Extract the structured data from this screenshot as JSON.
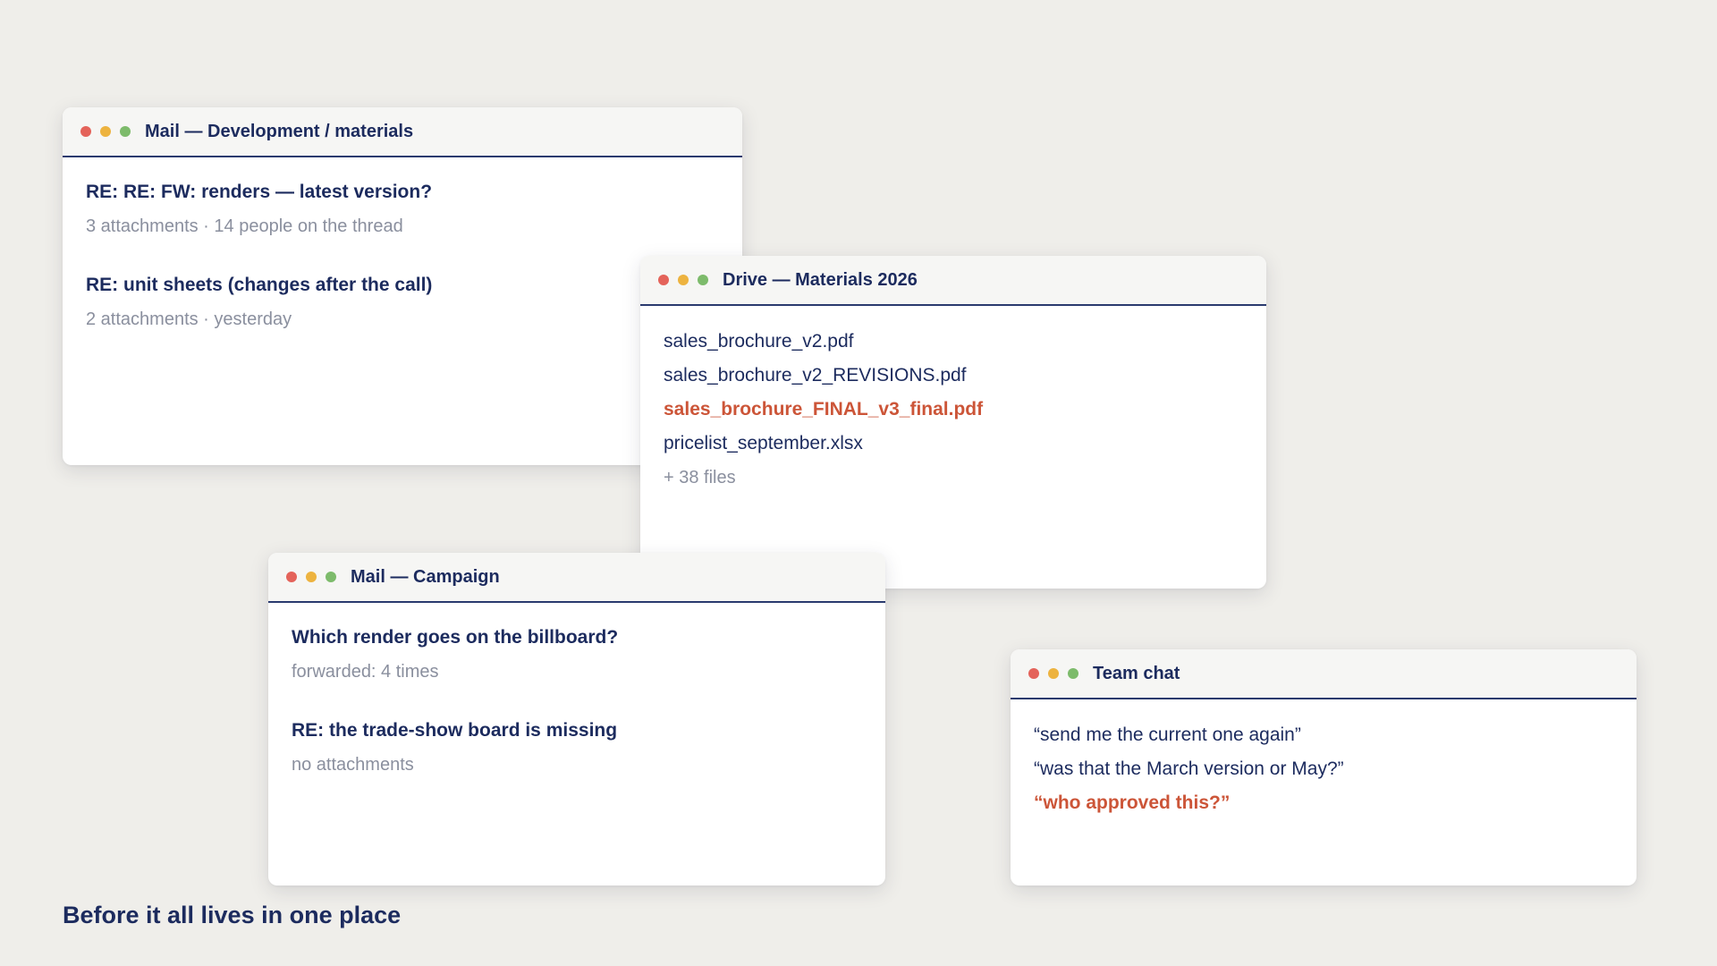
{
  "windows": {
    "mail_dev": {
      "title": "Mail — Development / materials",
      "items": [
        {
          "subject": "RE: RE: FW: renders — latest version?",
          "meta": "3 attachments · 14 people on the thread"
        },
        {
          "subject": "RE: unit sheets (changes after the call)",
          "meta": "2 attachments · yesterday"
        }
      ]
    },
    "drive": {
      "title": "Drive — Materials 2026",
      "files": [
        {
          "name": "sales_brochure_v2.pdf"
        },
        {
          "name": "sales_brochure_v2_REVISIONS.pdf"
        },
        {
          "name": "sales_brochure_FINAL_v3_final.pdf"
        },
        {
          "name": "pricelist_september.xlsx"
        }
      ],
      "more": "+ 38 files"
    },
    "mail_campaign": {
      "title": "Mail — Campaign",
      "items": [
        {
          "subject": "Which render goes on the billboard?",
          "meta": "forwarded: 4 times"
        },
        {
          "subject": "RE: the trade-show board is missing",
          "meta": "no attachments"
        }
      ]
    },
    "team_chat": {
      "title": "Team chat",
      "messages": [
        {
          "text": "“send me the current one again”"
        },
        {
          "text": "“was that the March version or May?”"
        },
        {
          "text": "“who approved this?”"
        }
      ]
    }
  },
  "caption": "Before it all lives in one place",
  "colors": {
    "background": "#efeeea",
    "text_primary": "#1c2b5e",
    "text_muted": "#8a8f9e",
    "highlight": "#cc5538",
    "dot_red": "#e4635a",
    "dot_yellow": "#edb33f",
    "dot_green": "#7dbb6b"
  }
}
